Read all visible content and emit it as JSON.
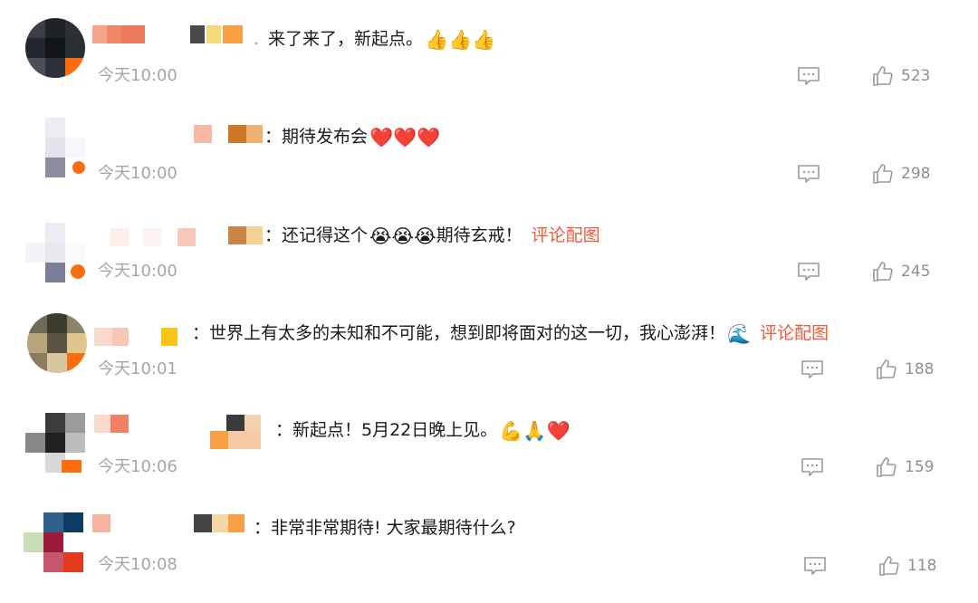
{
  "comments": [
    {
      "content": "来了来了，新起点。",
      "emojis": "👍👍👍",
      "link": "",
      "time": "今天10:00",
      "likes": "523",
      "icons": {
        "reply": "comment-icon",
        "like": "thumbs-up-icon"
      }
    },
    {
      "content": "：期待发布会",
      "emojis": "❤️❤️❤️",
      "link": "",
      "time": "今天10:00",
      "likes": "298",
      "icons": {
        "reply": "comment-icon",
        "like": "thumbs-up-icon"
      }
    },
    {
      "content": "：还记得这个",
      "emojis": "😭😭😭",
      "content_after": "期待玄戒！",
      "link": "评论配图",
      "time": "今天10:00",
      "likes": "245",
      "icons": {
        "reply": "comment-icon",
        "like": "thumbs-up-icon"
      }
    },
    {
      "content": "：世界上有太多的未知和不可能，想到即将面对的这一切，我心澎湃！",
      "emojis": "🌊",
      "link": "评论配图",
      "time": "今天10:01",
      "likes": "188",
      "icons": {
        "reply": "comment-icon",
        "like": "thumbs-up-icon"
      }
    },
    {
      "content": "：新起点！5月22日晚上见。",
      "emojis": "💪🙏❤️",
      "link": "",
      "time": "今天10:06",
      "likes": "159",
      "icons": {
        "reply": "comment-icon",
        "like": "thumbs-up-icon"
      }
    },
    {
      "content": "：非常非常期待! 大家最期待什么?",
      "emojis": "",
      "link": "",
      "time": "今天10:08",
      "likes": "118",
      "icons": {
        "reply": "comment-icon",
        "like": "thumbs-up-icon"
      }
    }
  ],
  "colors": {
    "link": "#f0593a",
    "time": "#a5a5a5",
    "count": "#8f8f8f",
    "icon": "#9a9a9a"
  }
}
